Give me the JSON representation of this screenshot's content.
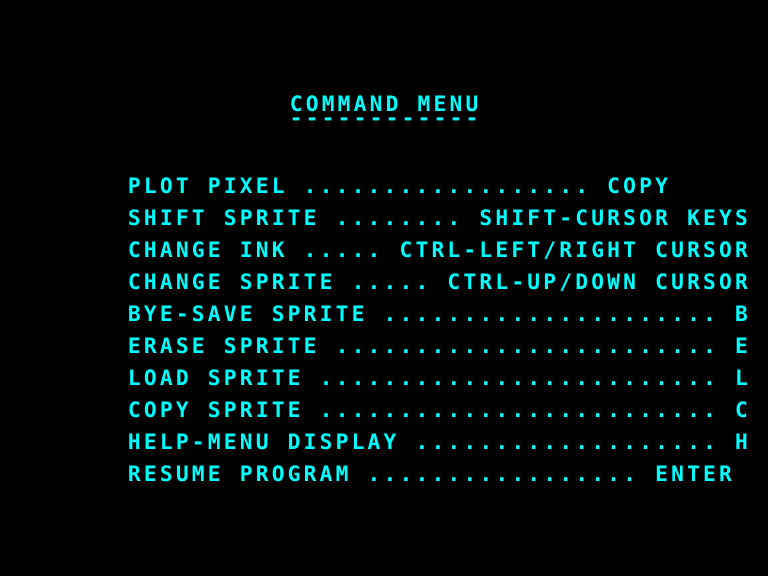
{
  "screen": {
    "background_color": "#000000",
    "text_color": "#00ffff",
    "columns": 40,
    "rows": 24
  },
  "title": {
    "text": "COMMAND MENU",
    "underline": "------------"
  },
  "menu": {
    "items": [
      {
        "label": "PLOT PIXEL",
        "leader": " .................. ",
        "key": "COPY",
        "line": "PLOT PIXEL .................. COPY"
      },
      {
        "label": "SHIFT SPRITE",
        "leader": " ........ ",
        "key": "SHIFT-CURSOR KEYS",
        "line": "SHIFT SPRITE ........ SHIFT-CURSOR KEYS"
      },
      {
        "label": "CHANGE INK",
        "leader": " ..... ",
        "key": "CTRL-LEFT/RIGHT CURSOR",
        "line": "CHANGE INK ..... CTRL-LEFT/RIGHT CURSOR"
      },
      {
        "label": "CHANGE SPRITE",
        "leader": " ..... ",
        "key": "CTRL-UP/DOWN CURSOR",
        "line": "CHANGE SPRITE ..... CTRL-UP/DOWN CURSOR"
      },
      {
        "label": "BYE-SAVE SPRITE",
        "leader": " ..................... ",
        "key": "B",
        "line": "BYE-SAVE SPRITE ..................... B"
      },
      {
        "label": "ERASE SPRITE",
        "leader": " ........................ ",
        "key": "E",
        "line": "ERASE SPRITE ........................ E"
      },
      {
        "label": "LOAD SPRITE",
        "leader": " ......................... ",
        "key": "L",
        "line": "LOAD SPRITE ......................... L"
      },
      {
        "label": "COPY SPRITE",
        "leader": " ......................... ",
        "key": "C",
        "line": "COPY SPRITE ......................... C"
      },
      {
        "label": "HELP-MENU DISPLAY",
        "leader": " ................... ",
        "key": "H",
        "line": "HELP-MENU DISPLAY ................... H"
      },
      {
        "label": "RESUME PROGRAM",
        "leader": " ................. ",
        "key": "ENTER",
        "line": "RESUME PROGRAM ................. ENTER"
      }
    ]
  }
}
